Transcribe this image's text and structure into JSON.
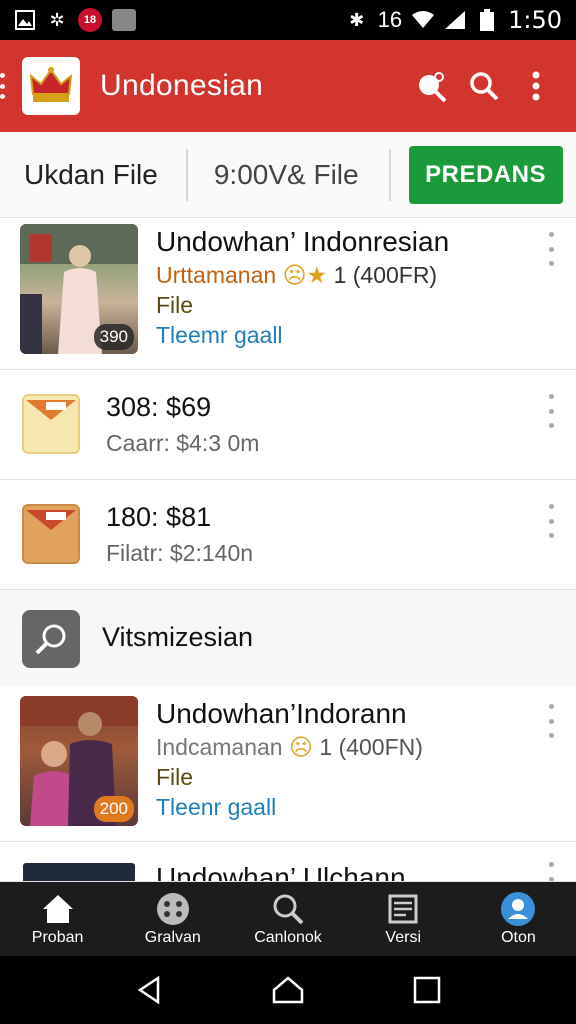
{
  "status_bar": {
    "notif_badge": "18",
    "signal_text": "16",
    "time": "1:50"
  },
  "app_bar": {
    "title": "Undonesian",
    "icons": [
      "crown-logo-icon",
      "voice-search-icon",
      "search-icon",
      "overflow-menu-icon"
    ]
  },
  "filter_bar": {
    "tab1": "Ukdan File",
    "tab2": "9:00V& File",
    "action_button": "PREDANS"
  },
  "list": {
    "item1": {
      "title": "Undowhan’ Indonresian",
      "sub1": "Urttamanan",
      "sub1_rating": "1 (400FR)",
      "sub2": "File",
      "sub3": "Tleemr gaall",
      "badge": "390",
      "sub1_color": "#c2610f"
    },
    "price1": {
      "line1": "308: $69",
      "line2": "Caarr: $4:3 0m"
    },
    "price2": {
      "line1": "180: $81",
      "line2": "Filatr: $2:140n"
    },
    "section": {
      "title": "Vitsmizesian"
    },
    "item2": {
      "title": "Undowhan’Indorann",
      "sub1": "Indcamanan",
      "sub1_rating": "1 (400FN)",
      "sub2": "File",
      "sub3": "Tleenr gaall",
      "badge": "200"
    },
    "item3": {
      "title": "Undowhan’ Ulchann"
    }
  },
  "bottom_nav": [
    {
      "label": "Proban",
      "icon": "home-icon"
    },
    {
      "label": "Gralvan",
      "icon": "grid-dots-icon"
    },
    {
      "label": "Canlonok",
      "icon": "search-icon"
    },
    {
      "label": "Versi",
      "icon": "news-icon"
    },
    {
      "label": "Oton",
      "icon": "profile-icon"
    }
  ],
  "colors": {
    "app_bar": "#d1352d",
    "action_button": "#1a9a3b",
    "link": "#1e7fb8"
  }
}
